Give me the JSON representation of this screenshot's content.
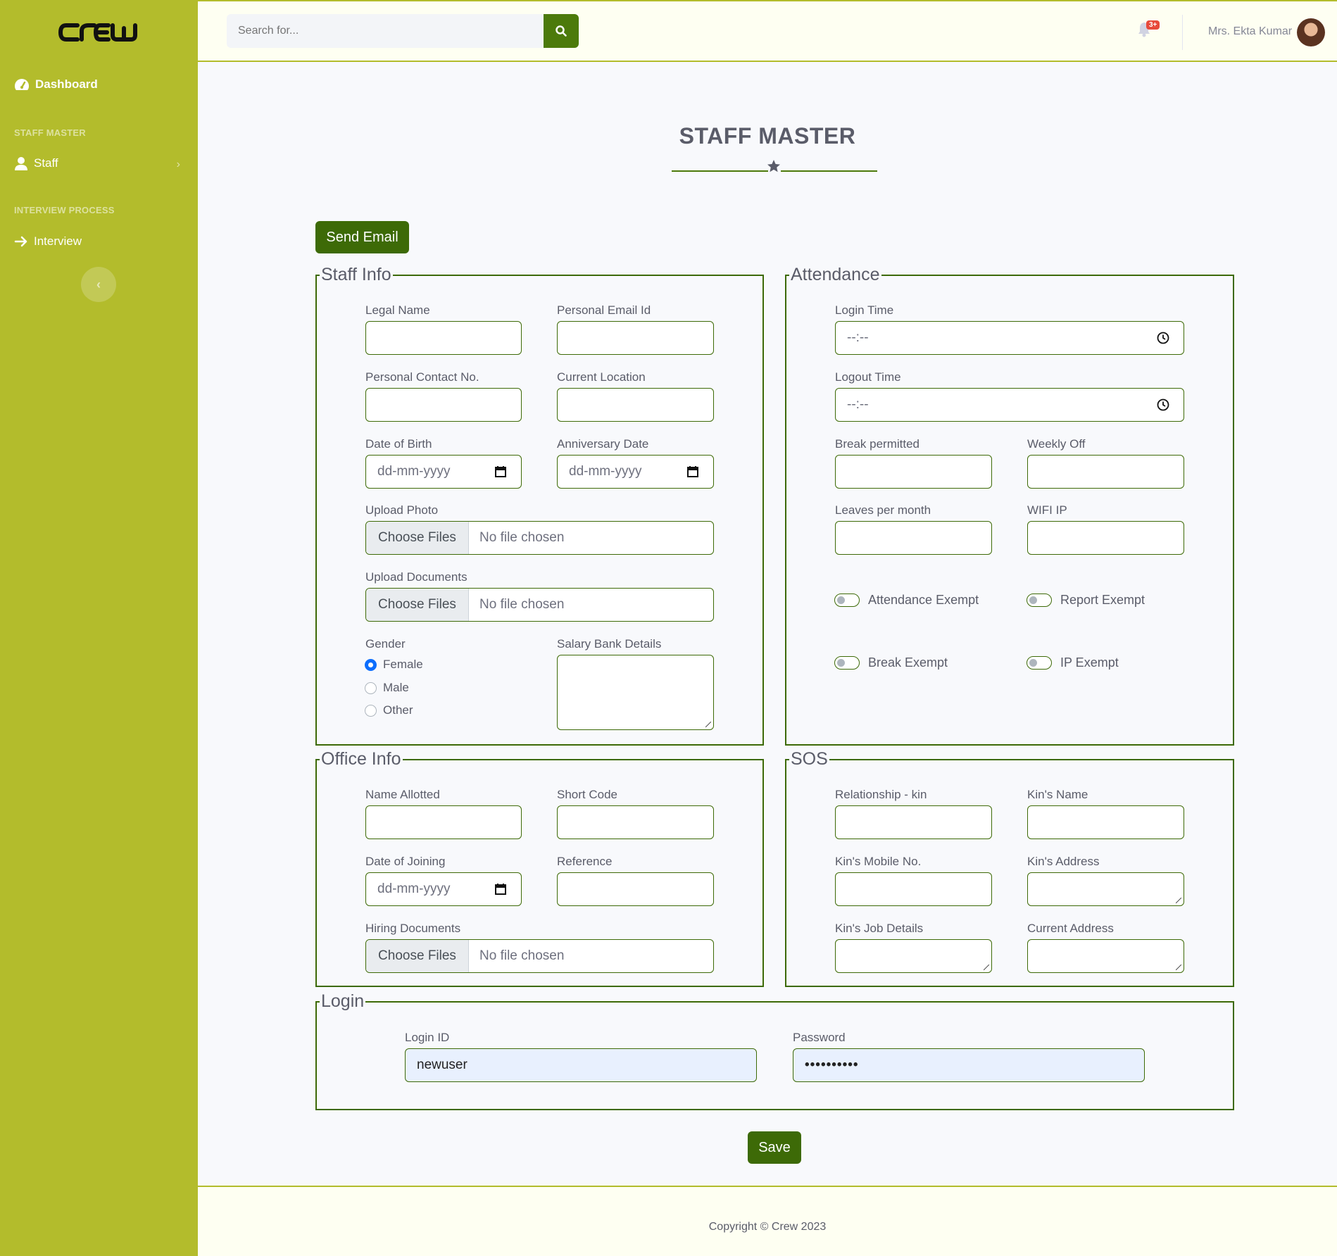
{
  "sidebar": {
    "brand": "crew",
    "dashboard_label": "Dashboard",
    "heading_staff": "STAFF MASTER",
    "staff_label": "Staff",
    "heading_interview": "INTERVIEW PROCESS",
    "interview_label": "Interview"
  },
  "topbar": {
    "search_placeholder": "Search for...",
    "notifications_badge": "3+",
    "user_name": "Mrs. Ekta Kumar"
  },
  "page": {
    "title": "STAFF MASTER",
    "send_email_label": "Send Email",
    "save_label": "Save"
  },
  "staff_info": {
    "legend": "Staff Info",
    "legal_name_label": "Legal Name",
    "personal_email_label": "Personal Email Id",
    "contact_label": "Personal Contact No.",
    "location_label": "Current Location",
    "dob_label": "Date of Birth",
    "dob_placeholder": "dd-mm-yyyy",
    "anniversary_label": "Anniversary Date",
    "anniversary_placeholder": "dd-mm-yyyy",
    "upload_photo_label": "Upload Photo",
    "upload_docs_label": "Upload Documents",
    "choose_files": "Choose Files",
    "no_file": "No file chosen",
    "gender_label": "Gender",
    "gender_options": [
      "Female",
      "Male",
      "Other"
    ],
    "gender_selected": "Female",
    "salary_label": "Salary Bank Details"
  },
  "attendance": {
    "legend": "Attendance",
    "login_time_label": "Login Time",
    "logout_time_label": "Logout Time",
    "time_placeholder": "--:--",
    "break_label": "Break permitted",
    "weekly_off_label": "Weekly Off",
    "leaves_label": "Leaves per month",
    "wifi_label": "WIFI IP",
    "attendance_exempt": "Attendance Exempt",
    "report_exempt": "Report Exempt",
    "break_exempt": "Break Exempt",
    "ip_exempt": "IP Exempt"
  },
  "office_info": {
    "legend": "Office Info",
    "name_allotted_label": "Name Allotted",
    "short_code_label": "Short Code",
    "doj_label": "Date of Joining",
    "doj_placeholder": "dd-mm-yyyy",
    "reference_label": "Reference",
    "hiring_docs_label": "Hiring Documents",
    "choose_files": "Choose Files",
    "no_file": "No file chosen"
  },
  "sos": {
    "legend": "SOS",
    "relationship_label": "Relationship - kin",
    "kin_name_label": "Kin's Name",
    "kin_mobile_label": "Kin's Mobile No.",
    "kin_address_label": "Kin's Address",
    "kin_job_label": "Kin's Job Details",
    "current_address_label": "Current Address"
  },
  "login": {
    "legend": "Login",
    "login_id_label": "Login ID",
    "login_id_value": "newuser",
    "password_label": "Password",
    "password_value": "••••••••••"
  },
  "footer": {
    "copyright": "Copyright © Crew 2023"
  },
  "colors": {
    "sidebar": "#b3bc2c",
    "accent": "#3d6a07",
    "topbar": "#fefff2"
  }
}
